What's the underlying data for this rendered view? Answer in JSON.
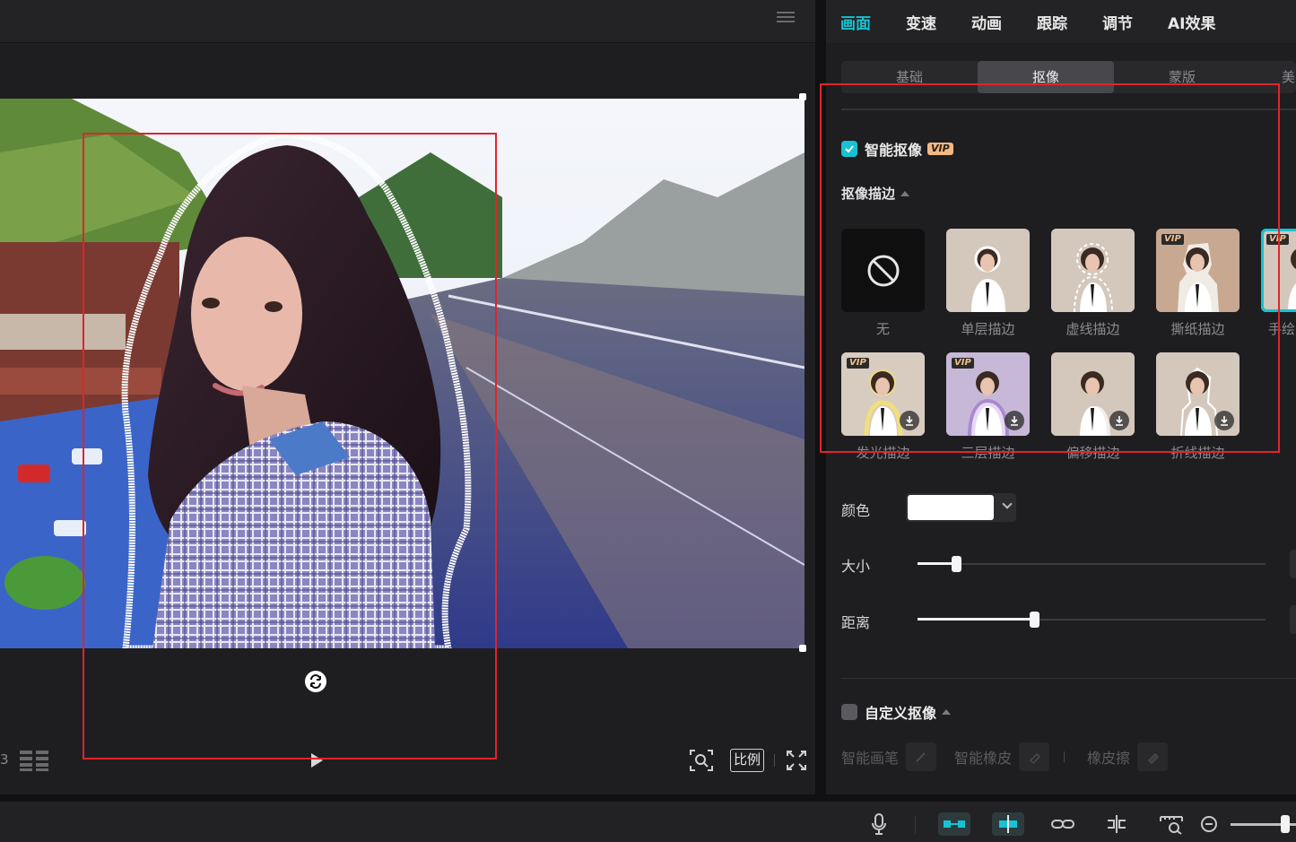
{
  "preview": {
    "frame_fragment": "3",
    "ratio_label": "比例"
  },
  "main_tabs": [
    {
      "label": "画面",
      "active": true
    },
    {
      "label": "变速",
      "active": false
    },
    {
      "label": "动画",
      "active": false
    },
    {
      "label": "跟踪",
      "active": false
    },
    {
      "label": "调节",
      "active": false
    },
    {
      "label": "AI效果",
      "active": false
    }
  ],
  "sub_tabs": [
    {
      "label": "基础",
      "active": false
    },
    {
      "label": "抠像",
      "active": true
    },
    {
      "label": "蒙版",
      "active": false
    },
    {
      "label": "美",
      "active": false
    }
  ],
  "smart_cutout": {
    "label": "智能抠像",
    "checked": true,
    "badge": "VIP"
  },
  "outline_section": {
    "title": "抠像描边"
  },
  "outline_presets": [
    {
      "name": "无",
      "vip": false,
      "download": false
    },
    {
      "name": "单层描边",
      "vip": false,
      "download": false
    },
    {
      "name": "虚线描边",
      "vip": false,
      "download": false
    },
    {
      "name": "撕纸描边",
      "vip": true,
      "download": false
    },
    {
      "name": "手绘",
      "vip": true,
      "download": false,
      "selected": true
    },
    {
      "name": "发光描边",
      "vip": true,
      "download": true
    },
    {
      "name": "三层描边",
      "vip": true,
      "download": true
    },
    {
      "name": "偏移描边",
      "vip": false,
      "download": true
    },
    {
      "name": "折线描边",
      "vip": false,
      "download": true
    }
  ],
  "vip_tag": "VIP",
  "color": {
    "label": "颜色",
    "value": "#ffffff"
  },
  "size": {
    "label": "大小",
    "value": 0.11
  },
  "distance": {
    "label": "距离",
    "value": 0.335
  },
  "custom_cutout": {
    "label": "自定义抠像",
    "checked": false
  },
  "custom_tools": {
    "brush": "智能画笔",
    "smart_eraser": "智能橡皮",
    "eraser": "橡皮擦"
  },
  "colors": {
    "accent": "#17c2d2",
    "panel": "#1e1e20",
    "annotation": "#e0242c"
  }
}
